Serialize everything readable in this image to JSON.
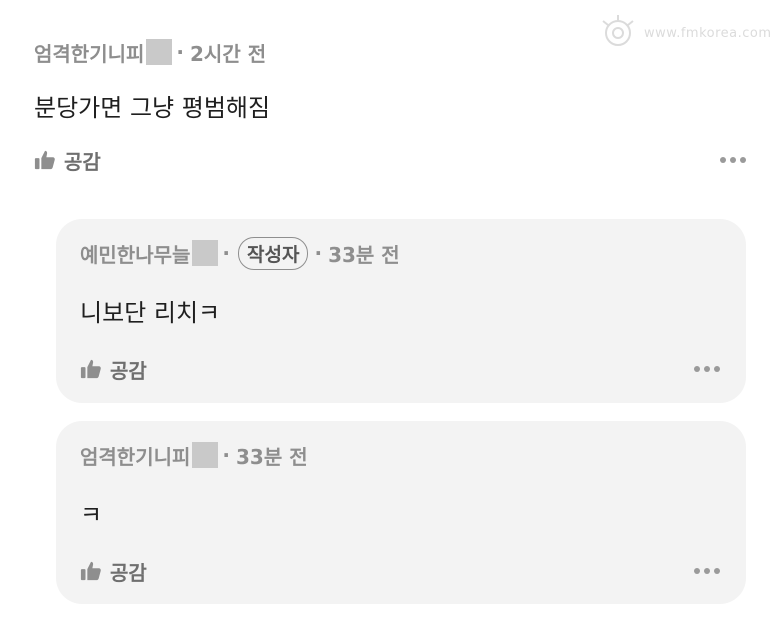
{
  "watermark": {
    "text": "www.fmkorea.com"
  },
  "comment": {
    "author": "엄격한기니피",
    "time": "2시간 전",
    "text": "분당가면 그냥 평범해짐",
    "like_label": "공감"
  },
  "replies": [
    {
      "author": "예민한나무늘",
      "badge": "작성자",
      "time": "33분 전",
      "text": "니보단 리치ㅋ",
      "like_label": "공감"
    },
    {
      "author": "엄격한기니피",
      "time": "33분 전",
      "text": "ㅋ",
      "like_label": "공감"
    }
  ]
}
